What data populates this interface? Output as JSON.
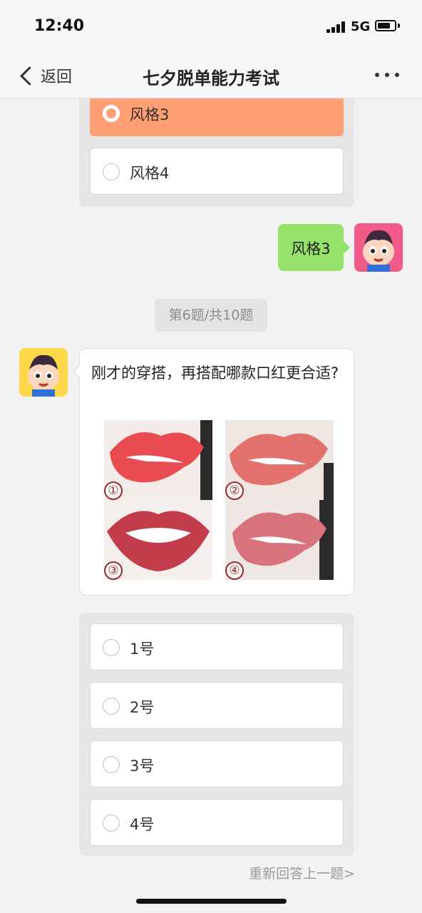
{
  "status_bar": {
    "time": "12:40",
    "network": "5G",
    "battery_level": 0.75
  },
  "nav": {
    "back_label": "返回",
    "title": "七夕脱单能力考试"
  },
  "prev_question": {
    "options": [
      {
        "label": "风格3",
        "selected": true
      },
      {
        "label": "风格4",
        "selected": false
      }
    ]
  },
  "user_answer": "风格3",
  "question_counter": "第6题/共10题",
  "question": {
    "text": "刚才的穿搭，再搭配哪款口红更合适?",
    "image_labels": [
      "①",
      "②",
      "③",
      "④"
    ],
    "lip_colors": [
      "#e84c52",
      "#e2706c",
      "#c23c4c",
      "#d8737d"
    ]
  },
  "answer_options": [
    {
      "label": "1号"
    },
    {
      "label": "2号"
    },
    {
      "label": "3号"
    },
    {
      "label": "4号"
    }
  ],
  "retry_label": "重新回答上一题>"
}
